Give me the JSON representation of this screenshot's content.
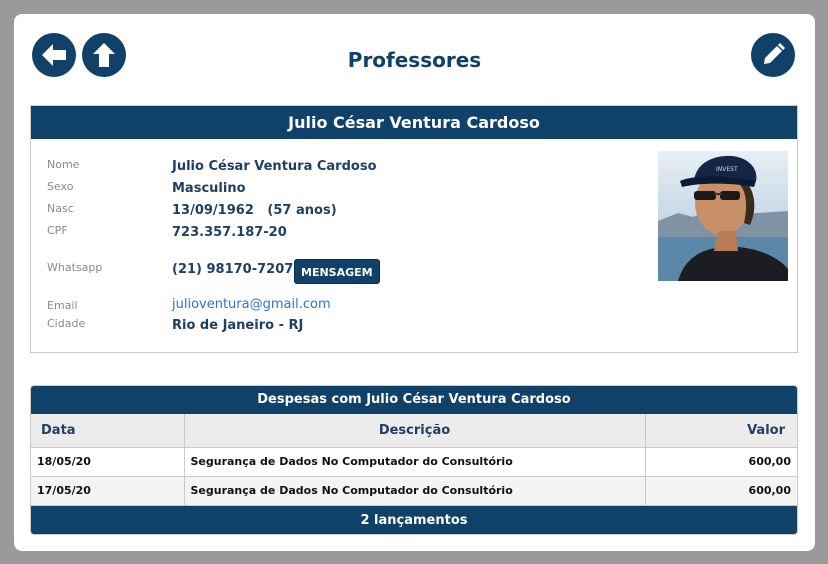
{
  "header": {
    "title": "Professores",
    "back_icon": "arrow-left-icon",
    "up_icon": "arrow-up-icon",
    "edit_icon": "pencil-icon"
  },
  "profile": {
    "header_name": "Julio César Ventura Cardoso",
    "fields": {
      "nome_label": "Nome",
      "nome": "Julio César Ventura Cardoso",
      "sexo_label": "Sexo",
      "sexo": "Masculino",
      "nasc_label": "Nasc",
      "nasc": "13/09/1962   (57 anos)",
      "cpf_label": "CPF",
      "cpf": "723.357.187-20",
      "whatsapp_label": "Whatsapp",
      "whatsapp": "(21) 98170-7207",
      "email_label": "Email",
      "email": "julioventura@gmail.com",
      "cidade_label": "Cidade",
      "cidade": "Rio de Janeiro - RJ"
    },
    "message_button": "MENSAGEM"
  },
  "expenses": {
    "title": "Despesas com Julio César Ventura Cardoso",
    "columns": [
      "Data",
      "Descrição",
      "Valor"
    ],
    "rows": [
      {
        "data": "18/05/20",
        "descricao": "Segurança de Dados No Computador do Consultório",
        "valor": "600,00"
      },
      {
        "data": "17/05/20",
        "descricao": "Segurança de Dados No Computador do Consultório",
        "valor": "600,00"
      }
    ],
    "footer": "2 lançamentos"
  },
  "colors": {
    "primary": "#0f4169",
    "link": "#2878c8",
    "background": "#9a9a9a"
  }
}
